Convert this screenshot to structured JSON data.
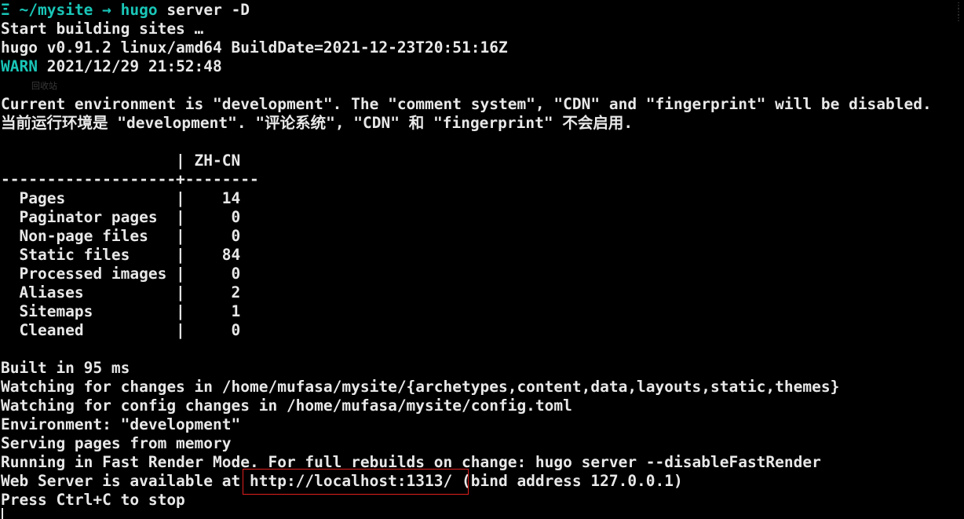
{
  "terminal": {
    "prompt": {
      "symbol": "Ξ",
      "path": "~/mysite",
      "arrow": "→",
      "command": "hugo",
      "args": "server -D"
    },
    "lines": [
      "Start building sites …",
      "hugo v0.91.2 linux/amd64 BuildDate=2021-12-23T20:51:16Z",
      "",
      "",
      "Current environment is \"development\". The \"comment system\", \"CDN\" and \"fingerprint\" will be disabled.",
      "当前运行环境是 \"development\". \"评论系统\", \"CDN\" 和 \"fingerprint\" 不会启用.",
      "",
      "                   | ZH-CN",
      "-------------------+--------",
      "  Pages            |    14",
      "  Paginator pages  |     0",
      "  Non-page files   |     0",
      "  Static files     |    84",
      "  Processed images |     0",
      "  Aliases          |     2",
      "  Sitemaps         |     1",
      "  Cleaned          |     0",
      "",
      "Built in 95 ms",
      "Watching for changes in /home/mufasa/mysite/{archetypes,content,data,layouts,static,themes}",
      "Watching for config changes in /home/mufasa/mysite/config.toml",
      "Environment: \"development\"",
      "Serving pages from memory",
      "Running in Fast Render Mode. For full rebuilds on change: hugo server --disableFastRender",
      "Web Server is available at http://localhost:1313/ (bind address 127.0.0.1)",
      "Press Ctrl+C to stop"
    ],
    "warn_label": "WARN",
    "warn_text": " 2021/12/29 21:52:48",
    "ghost_label": "回收站",
    "colors": {
      "background": "#000000",
      "text": "#e8e8e8",
      "accent": "#19c6b8",
      "highlight_box": "#e01e1e"
    }
  }
}
